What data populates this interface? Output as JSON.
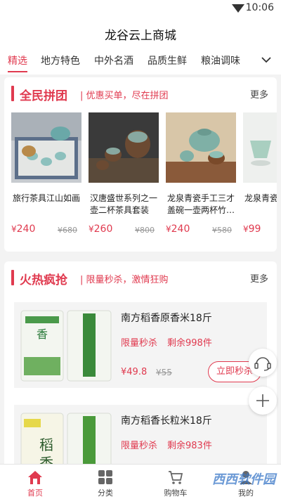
{
  "status": {
    "time": "10:06"
  },
  "header": {
    "title": "龙谷云上商城"
  },
  "tabs": [
    {
      "label": "精选"
    },
    {
      "label": "地方特色"
    },
    {
      "label": "中外名酒"
    },
    {
      "label": "品质生鲜"
    },
    {
      "label": "粮油调味"
    }
  ],
  "group_buy": {
    "title": "全民拼团",
    "subtitle": "| 优惠买单，尽在拼团",
    "more": "更多",
    "products": [
      {
        "name": "旅行茶具江山如画",
        "price": "240",
        "old_price": "¥680"
      },
      {
        "name": "汉唐盛世系列之一壶二杯茶具套装",
        "price": "260",
        "old_price": "¥800"
      },
      {
        "name": "龙泉青瓷手工三才盖碗一壶两杯竹…",
        "price": "240",
        "old_price": "¥580"
      },
      {
        "name": "龙泉青瓷杯三色",
        "price": "99",
        "old_price": ""
      }
    ],
    "currency": "¥"
  },
  "flash_sale": {
    "title": "火热疯抢",
    "subtitle": "| 限量秒杀，激情狂购",
    "more": "更多",
    "items": [
      {
        "name": "南方稻香原香米18斤",
        "tag": "限量秒杀",
        "remain": "剩余998件",
        "price": "¥49.8",
        "old_price": "¥55",
        "button": "立即秒杀"
      },
      {
        "name": "南方稻香长粒米18斤",
        "tag": "限量秒杀",
        "remain": "剩余983件"
      }
    ]
  },
  "bottom_nav": [
    {
      "label": "首页",
      "icon": "home-icon"
    },
    {
      "label": "分类",
      "icon": "grid-icon"
    },
    {
      "label": "购物车",
      "icon": "cart-icon"
    },
    {
      "label": "我的",
      "icon": "user-icon"
    }
  ],
  "watermark": "西西软件园",
  "colors": {
    "accent": "#e03a4f",
    "background": "#f3f3f3"
  }
}
